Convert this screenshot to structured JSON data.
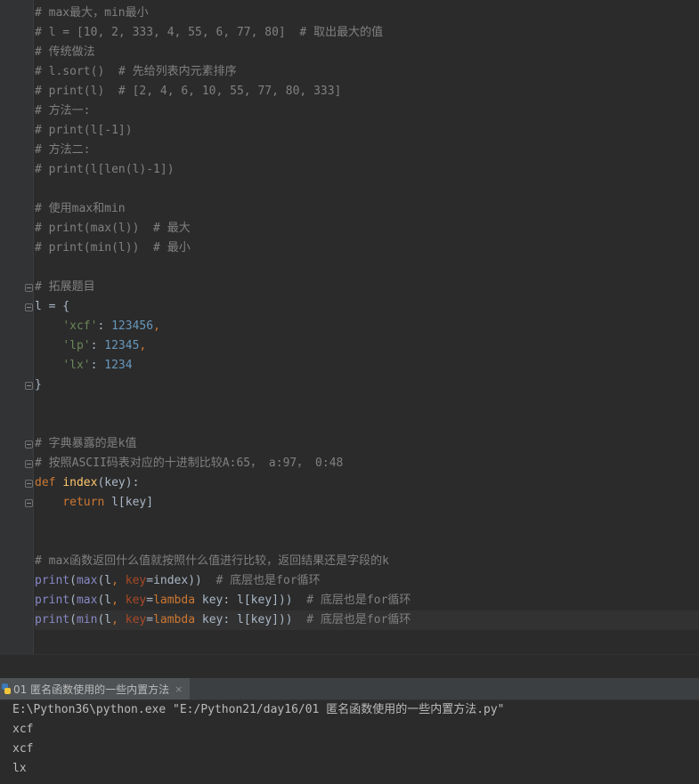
{
  "code": [
    {
      "segs": [
        {
          "t": "# max最大，min最小",
          "c": "c-com"
        }
      ]
    },
    {
      "segs": [
        {
          "t": "# l = [10, 2, 333, 4, 55, 6, 77, 80]  # 取出最大的值",
          "c": "c-com"
        }
      ]
    },
    {
      "segs": [
        {
          "t": "# 传统做法",
          "c": "c-com"
        }
      ]
    },
    {
      "segs": [
        {
          "t": "# l.sort()  # 先给列表内元素排序",
          "c": "c-com"
        }
      ]
    },
    {
      "segs": [
        {
          "t": "# print(l)  # [2, 4, 6, 10, 55, 77, 80, 333]",
          "c": "c-com"
        }
      ]
    },
    {
      "segs": [
        {
          "t": "# 方法一:",
          "c": "c-com"
        }
      ]
    },
    {
      "segs": [
        {
          "t": "# print(l[-1])",
          "c": "c-com"
        }
      ]
    },
    {
      "segs": [
        {
          "t": "# 方法二:",
          "c": "c-com"
        }
      ]
    },
    {
      "segs": [
        {
          "t": "# print(l[len(l)-1])",
          "c": "c-com"
        }
      ]
    },
    {
      "segs": []
    },
    {
      "segs": [
        {
          "t": "# 使用max和min",
          "c": "c-com"
        }
      ]
    },
    {
      "segs": [
        {
          "t": "# print(max(l))  # 最大",
          "c": "c-com"
        }
      ]
    },
    {
      "segs": [
        {
          "t": "# print(min(l))  # 最小",
          "c": "c-com"
        }
      ]
    },
    {
      "segs": []
    },
    {
      "segs": [
        {
          "t": "# 拓展题目",
          "c": "c-com"
        }
      ]
    },
    {
      "segs": [
        {
          "t": "l = {",
          "c": "c-txt"
        }
      ]
    },
    {
      "segs": [
        {
          "t": "    ",
          "c": "c-txt"
        },
        {
          "t": "'xcf'",
          "c": "c-str"
        },
        {
          "t": ": ",
          "c": "c-txt"
        },
        {
          "t": "123456",
          "c": "c-num"
        },
        {
          "t": ",",
          "c": "c-kw"
        }
      ]
    },
    {
      "segs": [
        {
          "t": "    ",
          "c": "c-txt"
        },
        {
          "t": "'lp'",
          "c": "c-str"
        },
        {
          "t": ": ",
          "c": "c-txt"
        },
        {
          "t": "12345",
          "c": "c-num"
        },
        {
          "t": ",",
          "c": "c-kw"
        }
      ]
    },
    {
      "segs": [
        {
          "t": "    ",
          "c": "c-txt"
        },
        {
          "t": "'lx'",
          "c": "c-str"
        },
        {
          "t": ": ",
          "c": "c-txt"
        },
        {
          "t": "1234",
          "c": "c-num"
        }
      ]
    },
    {
      "segs": [
        {
          "t": "}",
          "c": "c-txt"
        }
      ]
    },
    {
      "segs": []
    },
    {
      "segs": []
    },
    {
      "segs": [
        {
          "t": "# 字典暴露的是k值",
          "c": "c-com"
        }
      ]
    },
    {
      "segs": [
        {
          "t": "# 按照ASCII码表对应的十进制比较A:65， a:97， 0:48",
          "c": "c-com"
        }
      ]
    },
    {
      "segs": [
        {
          "t": "def ",
          "c": "c-kw"
        },
        {
          "t": "index",
          "c": "c-fn"
        },
        {
          "t": "(key):",
          "c": "c-txt"
        }
      ]
    },
    {
      "segs": [
        {
          "t": "    ",
          "c": "c-txt"
        },
        {
          "t": "return ",
          "c": "c-kw"
        },
        {
          "t": "l[key]",
          "c": "c-txt"
        }
      ]
    },
    {
      "segs": []
    },
    {
      "segs": []
    },
    {
      "segs": [
        {
          "t": "# max函数返回什么值就按照什么值进行比较，返回结果还是字段的k",
          "c": "c-com"
        }
      ]
    },
    {
      "segs": [
        {
          "t": "print",
          "c": "c-bi"
        },
        {
          "t": "(",
          "c": "c-txt"
        },
        {
          "t": "max",
          "c": "c-bi"
        },
        {
          "t": "(l",
          "c": "c-txt"
        },
        {
          "t": ", ",
          "c": "c-kw"
        },
        {
          "t": "key",
          "c": "c-par"
        },
        {
          "t": "=index))  ",
          "c": "c-txt"
        },
        {
          "t": "# 底层也是for循环",
          "c": "c-com"
        }
      ]
    },
    {
      "segs": [
        {
          "t": "print",
          "c": "c-bi"
        },
        {
          "t": "(",
          "c": "c-txt"
        },
        {
          "t": "max",
          "c": "c-bi"
        },
        {
          "t": "(l",
          "c": "c-txt"
        },
        {
          "t": ", ",
          "c": "c-kw"
        },
        {
          "t": "key",
          "c": "c-par"
        },
        {
          "t": "=",
          "c": "c-txt"
        },
        {
          "t": "lambda ",
          "c": "c-kw"
        },
        {
          "t": "key: l[key]))  ",
          "c": "c-txt"
        },
        {
          "t": "# 底层也是for循环",
          "c": "c-com"
        }
      ]
    },
    {
      "segs": [
        {
          "t": "print",
          "c": "c-bi"
        },
        {
          "t": "(",
          "c": "c-txt"
        },
        {
          "t": "min",
          "c": "c-bi"
        },
        {
          "t": "(l",
          "c": "c-txt"
        },
        {
          "t": ", ",
          "c": "c-kw"
        },
        {
          "t": "key",
          "c": "c-par"
        },
        {
          "t": "=",
          "c": "c-txt"
        },
        {
          "t": "lambda ",
          "c": "c-kw"
        },
        {
          "t": "key: l[key]))  ",
          "c": "c-txt"
        },
        {
          "t": "# 底层也是for循环",
          "c": "c-com"
        }
      ],
      "highlight": true
    }
  ],
  "run_tab": {
    "label": "01 匿名函数使用的一些内置方法",
    "close": "×",
    "icon": "python-icon"
  },
  "console": {
    "lines": [
      "E:\\Python36\\python.exe \"E:/Python21/day16/01 匿名函数使用的一些内置方法.py\"",
      "xcf",
      "xcf",
      "lx"
    ]
  }
}
